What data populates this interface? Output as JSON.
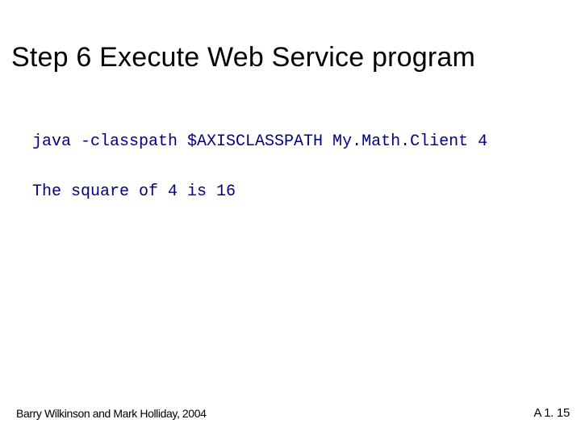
{
  "title": "Step 6 Execute Web Service program",
  "code": {
    "line1": "java -classpath $AXISCLASSPATH My.Math.Client 4",
    "line2": "The square of 4 is 16"
  },
  "footer": {
    "left": "Barry Wilkinson and Mark Holliday, 2004",
    "right": "A 1. 15"
  }
}
